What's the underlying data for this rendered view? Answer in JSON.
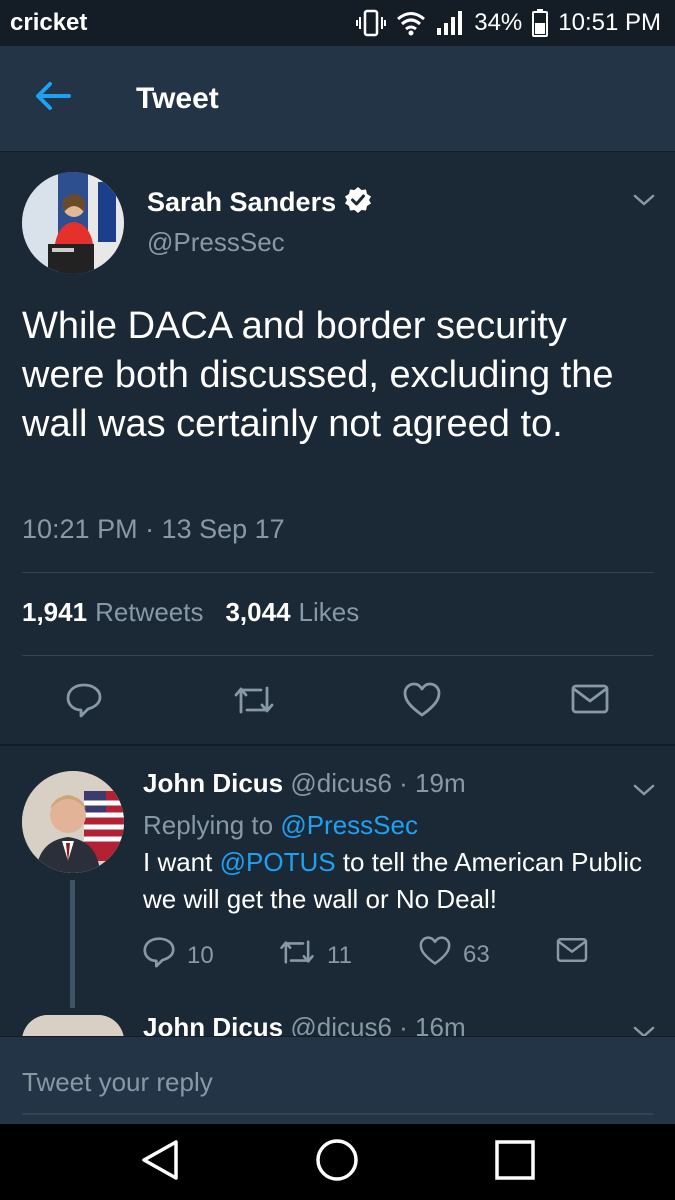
{
  "status_bar": {
    "carrier": "cricket",
    "battery": "34%",
    "time": "10:51 PM"
  },
  "header": {
    "title": "Tweet",
    "back_icon": "arrow-left-icon",
    "accent": "#1da1f2"
  },
  "main_tweet": {
    "display_name": "Sarah Sanders",
    "handle": "@PressSec",
    "verified": true,
    "text": "While DACA and border security were both discussed, excluding the wall was certainly not agreed to.",
    "timestamp": "10:21 PM · 13 Sep 17",
    "retweets_count": "1,941",
    "retweets_label": "Retweets",
    "likes_count": "3,044",
    "likes_label": "Likes",
    "actions": [
      "reply-icon",
      "retweet-icon",
      "like-icon",
      "share-icon"
    ]
  },
  "replies": [
    {
      "display_name": "John Dicus",
      "meta": "@dicus6 · 19m",
      "replying_prefix": "Replying to",
      "replying_to": "@PressSec",
      "mention": "@POTUS",
      "text_before": "I want",
      "text_after": "to tell the American Public we will get the wall or No Deal!",
      "reply_count": "10",
      "retweet_count": "11",
      "like_count": "63"
    },
    {
      "display_name": "John Dicus",
      "meta": "@dicus6 · 16m"
    }
  ],
  "composer": {
    "placeholder": "Tweet your reply"
  },
  "nav_bar": [
    "back-triangle-icon",
    "home-circle-icon",
    "recents-square-icon"
  ],
  "colors": {
    "background": "#1b2836",
    "header_bg": "#243447",
    "muted": "#8899a6",
    "link": "#1da1f2"
  }
}
